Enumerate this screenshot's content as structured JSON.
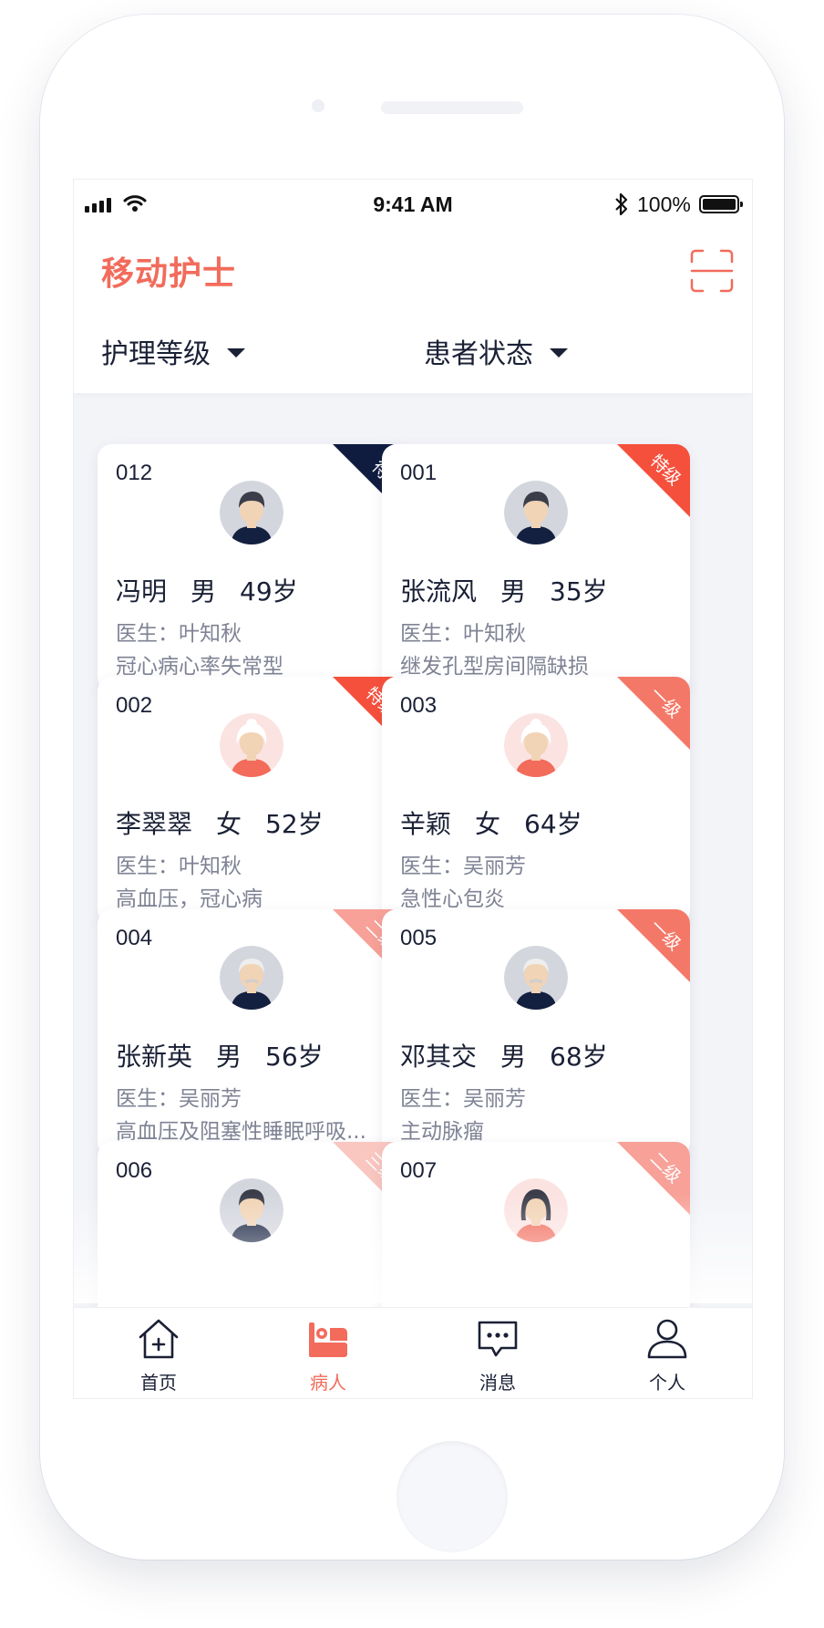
{
  "status_bar": {
    "time": "9:41 AM",
    "battery": "100%"
  },
  "header": {
    "title": "移动护士",
    "filters": [
      {
        "label": "护理等级"
      },
      {
        "label": "患者状态"
      }
    ]
  },
  "colors": {
    "accent": "#f26b5b",
    "navy": "#0f1c3f",
    "special": "#f5503c",
    "level1": "#f47868",
    "level2": "#f7a198",
    "level3": "#f9c6c0"
  },
  "patients": [
    {
      "bed": "012",
      "level": "待",
      "name": "冯明",
      "sex": "男",
      "age": "49岁",
      "doctor": "医生：叶知秋",
      "diagnosis": "冠心病心率失常型",
      "avatar": "young-man"
    },
    {
      "bed": "001",
      "level": "特级",
      "name": "张流风",
      "sex": "男",
      "age": "35岁",
      "doctor": "医生：叶知秋",
      "diagnosis": "继发孔型房间隔缺损",
      "avatar": "young-man"
    },
    {
      "bed": "002",
      "level": "特级",
      "name": "李翠翠",
      "sex": "女",
      "age": "52岁",
      "doctor": "医生：叶知秋",
      "diagnosis": "高血压，冠心病",
      "avatar": "old-woman"
    },
    {
      "bed": "003",
      "level": "一级",
      "name": "辛颖",
      "sex": "女",
      "age": "64岁",
      "doctor": "医生：吴丽芳",
      "diagnosis": "急性心包炎",
      "avatar": "old-woman"
    },
    {
      "bed": "004",
      "level": "二级",
      "name": "张新英",
      "sex": "男",
      "age": "56岁",
      "doctor": "医生：吴丽芳",
      "diagnosis": "高血压及阻塞性睡眠呼吸...",
      "avatar": "old-man"
    },
    {
      "bed": "005",
      "level": "一级",
      "name": "邓其交",
      "sex": "男",
      "age": "68岁",
      "doctor": "医生：吴丽芳",
      "diagnosis": "主动脉瘤",
      "avatar": "old-man"
    },
    {
      "bed": "006",
      "level": "三级",
      "name": "",
      "sex": "",
      "age": "",
      "doctor": "",
      "diagnosis": "",
      "avatar": "young-man"
    },
    {
      "bed": "007",
      "level": "二级",
      "name": "",
      "sex": "",
      "age": "",
      "doctor": "",
      "diagnosis": "",
      "avatar": "young-woman"
    }
  ],
  "tabbar": [
    {
      "label": "首页",
      "icon": "home-plus-icon",
      "active": false
    },
    {
      "label": "病人",
      "icon": "patient-bed-icon",
      "active": true
    },
    {
      "label": "消息",
      "icon": "message-icon",
      "active": false
    },
    {
      "label": "个人",
      "icon": "user-icon",
      "active": false
    }
  ]
}
